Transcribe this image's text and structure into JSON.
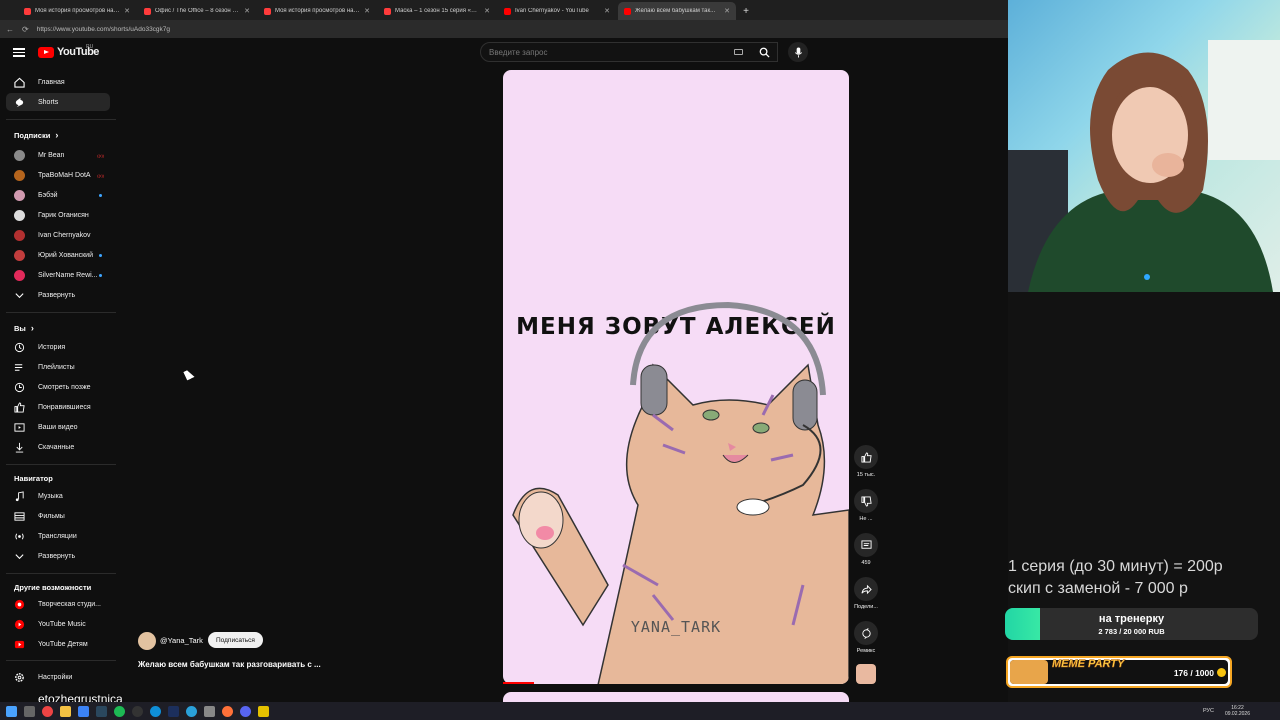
{
  "browser": {
    "tabs": [
      {
        "title": "Моя история просмотров на R...",
        "color": "#ff3b3b"
      },
      {
        "title": "Офис / The Office – 8 сезон 7 се...",
        "color": "#ff3b3b"
      },
      {
        "title": "Моя история просмотров на R...",
        "color": "#ff3b3b"
      },
      {
        "title": "Маска – 1 сезон 15 серия «Разд...",
        "color": "#ff3b3b"
      },
      {
        "title": "Ivan Chernyakov - YouTube",
        "color": "#ff0000"
      },
      {
        "title": "Желаю всем бабушкам так...",
        "color": "#ff0000"
      }
    ],
    "url": "https://www.youtube.com/shorts/uAdo33cgk7g"
  },
  "header": {
    "logo": "YouTube",
    "region": "RU",
    "search_placeholder": "Введите запрос"
  },
  "sidebar": {
    "main": [
      {
        "label": "Главная",
        "icon": "home-icon"
      },
      {
        "label": "Shorts",
        "icon": "shorts-icon"
      }
    ],
    "subs_title": "Подписки",
    "subs": [
      {
        "label": "Mr Bean",
        "badge": "live",
        "avatar": "#8a8a8a"
      },
      {
        "label": "ТраВоМаН DotA",
        "badge": "live",
        "avatar": "#b5651d"
      },
      {
        "label": "Бэбэй",
        "badge": "dot",
        "avatar": "#d19ab0"
      },
      {
        "label": "Гарик Оганисян",
        "badge": "",
        "avatar": "#dcdcdc"
      },
      {
        "label": "Ivan Chernyakov",
        "badge": "",
        "avatar": "#b23030"
      },
      {
        "label": "Юрий Хованский",
        "badge": "dot",
        "avatar": "#c23d3d"
      },
      {
        "label": "SilverName Rewi...",
        "badge": "dot",
        "avatar": "#e22a5a"
      }
    ],
    "subs_expand": "Развернуть",
    "you_title": "Вы",
    "you": [
      {
        "label": "История",
        "icon": "history-icon"
      },
      {
        "label": "Плейлисты",
        "icon": "playlist-icon"
      },
      {
        "label": "Смотреть позже",
        "icon": "clock-icon"
      },
      {
        "label": "Понравившиеся",
        "icon": "thumb-up-icon"
      },
      {
        "label": "Ваши видео",
        "icon": "video-icon"
      },
      {
        "label": "Скачанные",
        "icon": "download-icon"
      }
    ],
    "nav_title": "Навигатор",
    "nav": [
      {
        "label": "Музыка",
        "icon": "music-icon"
      },
      {
        "label": "Фильмы",
        "icon": "film-icon"
      },
      {
        "label": "Трансляции",
        "icon": "live-icon"
      },
      {
        "label": "Развернуть",
        "icon": "chevron-down-icon"
      }
    ],
    "more_title": "Другие возможности",
    "more": [
      {
        "label": "Творческая студи...",
        "icon": "studio-icon"
      },
      {
        "label": "YouTube Music",
        "icon": "yt-music-icon"
      },
      {
        "label": "YouTube Детям",
        "icon": "yt-kids-icon"
      }
    ],
    "settings": "Настройки"
  },
  "short": {
    "image_text": "МЕНЯ ЗОВУТ АЛЕКСЕЙ",
    "watermark": "YANA_TARK",
    "progress": 0.09,
    "channel": "@Yana_Tark",
    "subscribe": "Подписаться",
    "title": "Желаю всем бабушкам так разговаривать с ...",
    "actions": {
      "likes": "15 тыс.",
      "dislike": "Не ...",
      "comments": "459",
      "share": "Подели...",
      "remix": "Ремикс"
    }
  },
  "stream": {
    "price1": "1 серия (до 30 минут) = 200р",
    "price2": "скип с заменой - 7 000 р",
    "goal_title": "на тренерку",
    "goal_amount": "2 783 / 20 000 RUB",
    "goal_progress": 0.139,
    "meme_title": "MEME PARTY",
    "meme_count": "176 / 1000",
    "nick": "etozhegrustnica"
  },
  "taskbar": {
    "time": "16:22",
    "date": "09.02.2026",
    "lang": "РУС"
  }
}
